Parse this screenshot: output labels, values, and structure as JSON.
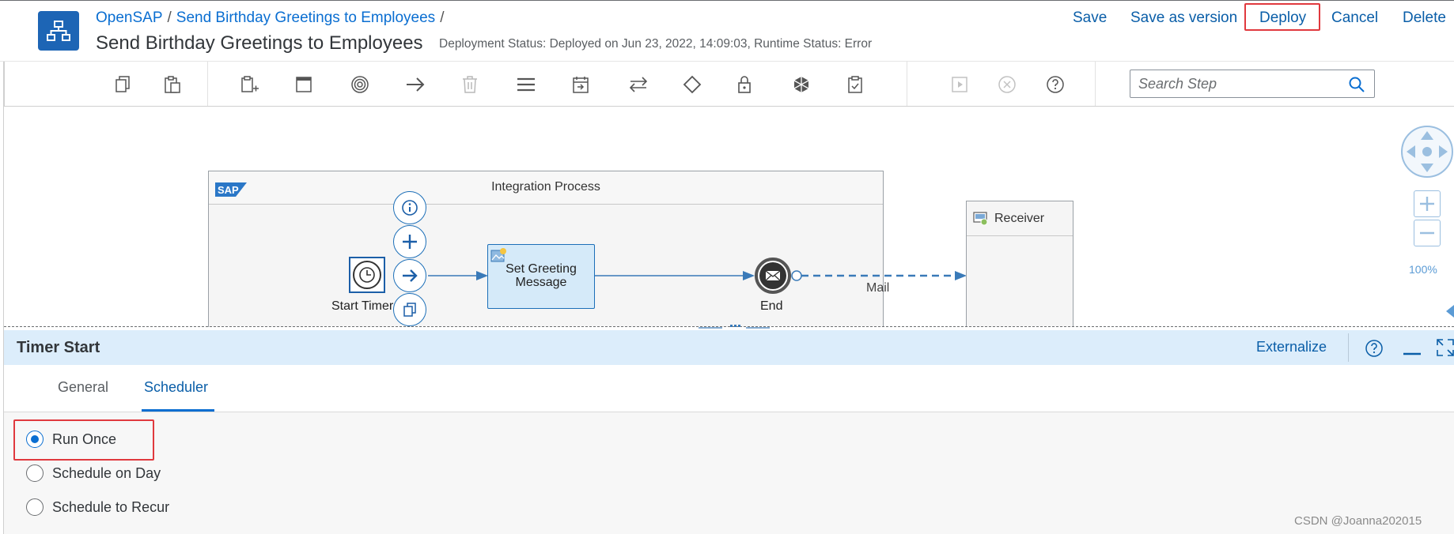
{
  "header": {
    "breadcrumb": [
      "OpenSAP",
      "Send Birthday Greetings to Employees"
    ],
    "breadcrumb_separator": "/",
    "title": "Send Birthday Greetings to Employees",
    "deployment_status": "Deployment Status: Deployed on Jun 23, 2022, 14:09:03, Runtime Status: Error",
    "actions": {
      "save": "Save",
      "save_as_version": "Save as version",
      "deploy": "Deploy",
      "cancel": "Cancel",
      "delete": "Delete"
    },
    "app_icon": "hierarchy-icon"
  },
  "toolbar": {
    "icons": [
      "copy-icon",
      "paste-icon",
      "add-participant-icon",
      "window-icon",
      "target-icon",
      "arrow-right-icon",
      "delete-icon",
      "menu-icon",
      "calendar-step-icon",
      "swap-arrows-icon",
      "diamond-icon",
      "lock-icon",
      "blocks-icon",
      "clipboard-check-icon",
      "play-icon",
      "cancel-circle-icon",
      "help-icon"
    ],
    "search_placeholder": "Search Step"
  },
  "canvas": {
    "integration_process_title": "Integration Process",
    "sap_logo": "SAP",
    "start_timer_label": "Start Timer",
    "set_greeting_label_line1": "Set Greeting",
    "set_greeting_label_line2": "Message",
    "end_label": "End",
    "mail_label": "Mail",
    "receiver_label": "Receiver",
    "zoom_level": "100%"
  },
  "properties": {
    "title": "Timer Start",
    "externalize": "Externalize",
    "tabs": [
      {
        "label": "General",
        "active": false
      },
      {
        "label": "Scheduler",
        "active": true
      }
    ],
    "scheduler_options": [
      {
        "label": "Run Once",
        "selected": true
      },
      {
        "label": "Schedule on Day",
        "selected": false
      },
      {
        "label": "Schedule to Recur",
        "selected": false
      }
    ]
  },
  "watermark": "CSDN @Joanna202015",
  "colors": {
    "brand": "#1d65b5",
    "link": "#0a6ed1",
    "highlight_box": "#e0393e",
    "panel_header": "#dcedfb"
  }
}
